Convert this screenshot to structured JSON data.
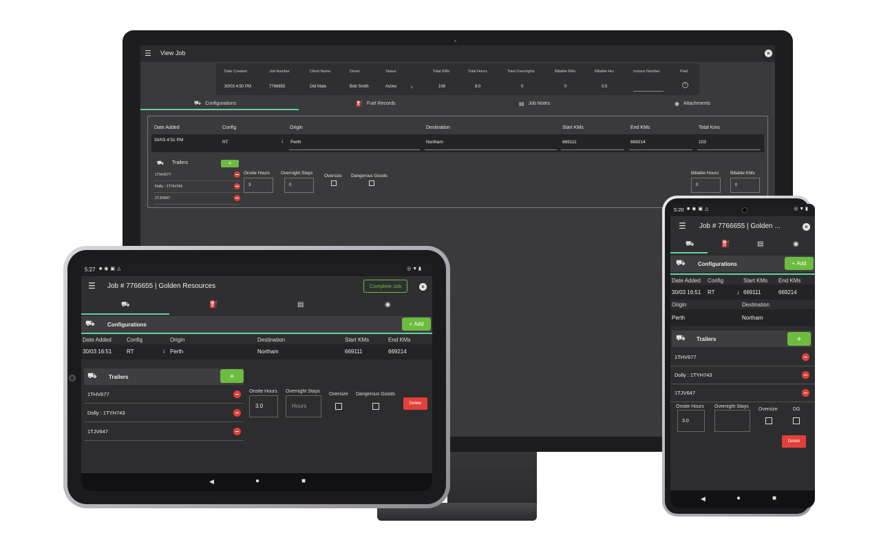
{
  "monitor": {
    "title": "View Job",
    "menu_icon": "hamburger-icon",
    "close_icon": "close-icon",
    "summary": {
      "headers": [
        "Date Created",
        "Job Number",
        "Client Name",
        "Driver",
        "Status",
        "Total KMs",
        "Total Hours",
        "Total Overnights",
        "Billable KMs",
        "Billable Hrs",
        "Invoice Number",
        "Paid"
      ],
      "values": [
        "30/03 4:50 PM",
        "7766655",
        "Old Mate",
        "Bob Smith",
        "Active",
        "108",
        "8.0",
        "0",
        "0",
        "0.0",
        "",
        ""
      ]
    },
    "tabs": [
      {
        "label": "Configurations",
        "icon": "truck-icon"
      },
      {
        "label": "Fuel Records",
        "icon": "fuel-icon"
      },
      {
        "label": "Job Notes",
        "icon": "document-icon"
      },
      {
        "label": "Attachments",
        "icon": "camera-icon"
      }
    ],
    "config_headers": [
      "Date Added",
      "Config",
      "Origin",
      "Destination",
      "Start KMs",
      "End KMs",
      "Total Kms"
    ],
    "config_row": {
      "date_added": "30/03 4:51 PM",
      "config": "RT",
      "origin": "Perth",
      "destination": "Northam",
      "start_kms": "669111",
      "end_kms": "669214",
      "total_kms": "103"
    },
    "trailers_label": "Trailers",
    "add_label": "+",
    "trailers": [
      "1THV677",
      "Dolly : 1TYH743",
      "1TJV647"
    ],
    "fields": {
      "onsite_hours_label": "Onsite Hours",
      "onsite_hours_value": "3",
      "overnight_stays_label": "Overnight Stays",
      "overnight_stays_value": "0",
      "oversize_label": "Oversize",
      "dangerous_goods_label": "Dangerous Goods",
      "billable_hours_label": "Billable Hours",
      "billable_hours_value": "0",
      "billable_kms_label": "Billable KMs",
      "billable_kms_value": "0"
    }
  },
  "tablet": {
    "status_time": "5:27",
    "title": "Job # 7766655 | Golden Resources",
    "complete_label": "Complete Job",
    "section_label": "Configurations",
    "add_label": "Add",
    "headers": [
      "Date Added",
      "Config",
      "Origin",
      "Destination",
      "Start KMs",
      "End KMs"
    ],
    "row": {
      "date_added": "30/03 16:51",
      "config": "RT",
      "origin": "Perth",
      "destination": "Northam",
      "start_kms": "669111",
      "end_kms": "669214"
    },
    "trailers_label": "Trailers",
    "trailer_add_label": "+",
    "trailers": [
      "1THV677",
      "Dolly : 1TYH743",
      "1TJV647"
    ],
    "onsite_hours_label": "Onsite Hours",
    "onsite_hours_value": "3.0",
    "overnight_stays_label": "Overnight Stays",
    "overnight_stays_placeholder": "Hours",
    "oversize_label": "Oversize",
    "dangerous_goods_label": "Dangerous Goods",
    "delete_label": "Delete"
  },
  "phone": {
    "status_time": "5:20",
    "title": "Job # 7766655 | Golden ...",
    "section_label": "Configurations",
    "add_label": "Add",
    "headers1": [
      "Date Added",
      "Config",
      "Start KMs",
      "End KMs"
    ],
    "values1": [
      "30/03 16:51",
      "RT",
      "669111",
      "669214"
    ],
    "headers2": [
      "Origin",
      "Destination"
    ],
    "values2": [
      "Perth",
      "Northam"
    ],
    "trailers_label": "Trailers",
    "trailer_add_label": "+",
    "trailers": [
      "1THV677",
      "Dolly : 1TYH743",
      "1TJV647"
    ],
    "onsite_hours_label": "Onsite Hours",
    "onsite_hours_value": "3.0",
    "overnight_stays_label": "Overnight Stays",
    "oversize_label": "Oversize",
    "dg_label": "DG",
    "delete_label": "Delete"
  },
  "colors": {
    "accent_green": "#6dbb3f",
    "tab_underline": "#5fd4a4",
    "delete_red": "#e2403a",
    "background": "#2d2d2f"
  }
}
